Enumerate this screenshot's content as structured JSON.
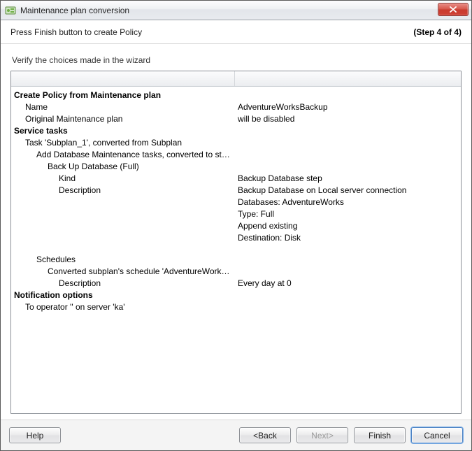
{
  "window": {
    "title": "Maintenance plan conversion"
  },
  "header": {
    "instruction": "Press Finish button to create Policy",
    "step": "(Step 4 of 4)"
  },
  "verify_label": "Verify the choices made in the wizard",
  "rows": [
    {
      "indent": 0,
      "section": true,
      "key": "Create Policy from Maintenance plan",
      "value": ""
    },
    {
      "indent": 1,
      "section": false,
      "key": "Name",
      "value": "AdventureWorksBackup"
    },
    {
      "indent": 1,
      "section": false,
      "key": "Original Maintenance plan",
      "value": "will be disabled"
    },
    {
      "indent": 0,
      "section": true,
      "key": "Service tasks",
      "value": ""
    },
    {
      "indent": 1,
      "section": false,
      "key": "Task 'Subplan_1', converted from Subplan",
      "value": ""
    },
    {
      "indent": 2,
      "section": false,
      "key": "Add Database Maintenance tasks, converted to steps",
      "value": ""
    },
    {
      "indent": 3,
      "section": false,
      "key": "Back Up Database (Full)",
      "value": ""
    },
    {
      "indent": 4,
      "section": false,
      "key": "Kind",
      "value": "Backup Database step"
    },
    {
      "indent": 4,
      "section": false,
      "key": "Description",
      "value": "Backup Database on Local server connection\nDatabases: AdventureWorks\nType: Full\nAppend existing\nDestination: Disk"
    },
    {
      "indent": 2,
      "section": false,
      "key": "Schedules",
      "value": ""
    },
    {
      "indent": 3,
      "section": false,
      "key": "Converted subplan's schedule 'AdventureWorksBac...",
      "value": ""
    },
    {
      "indent": 4,
      "section": false,
      "key": "Description",
      "value": "Every day at 0"
    },
    {
      "indent": 0,
      "section": true,
      "key": "Notification options",
      "value": ""
    },
    {
      "indent": 1,
      "section": false,
      "key": "To operator '' on server 'ka'",
      "value": ""
    }
  ],
  "buttons": {
    "help": "Help",
    "back": "<Back",
    "next": "Next>",
    "finish": "Finish",
    "cancel": "Cancel"
  }
}
